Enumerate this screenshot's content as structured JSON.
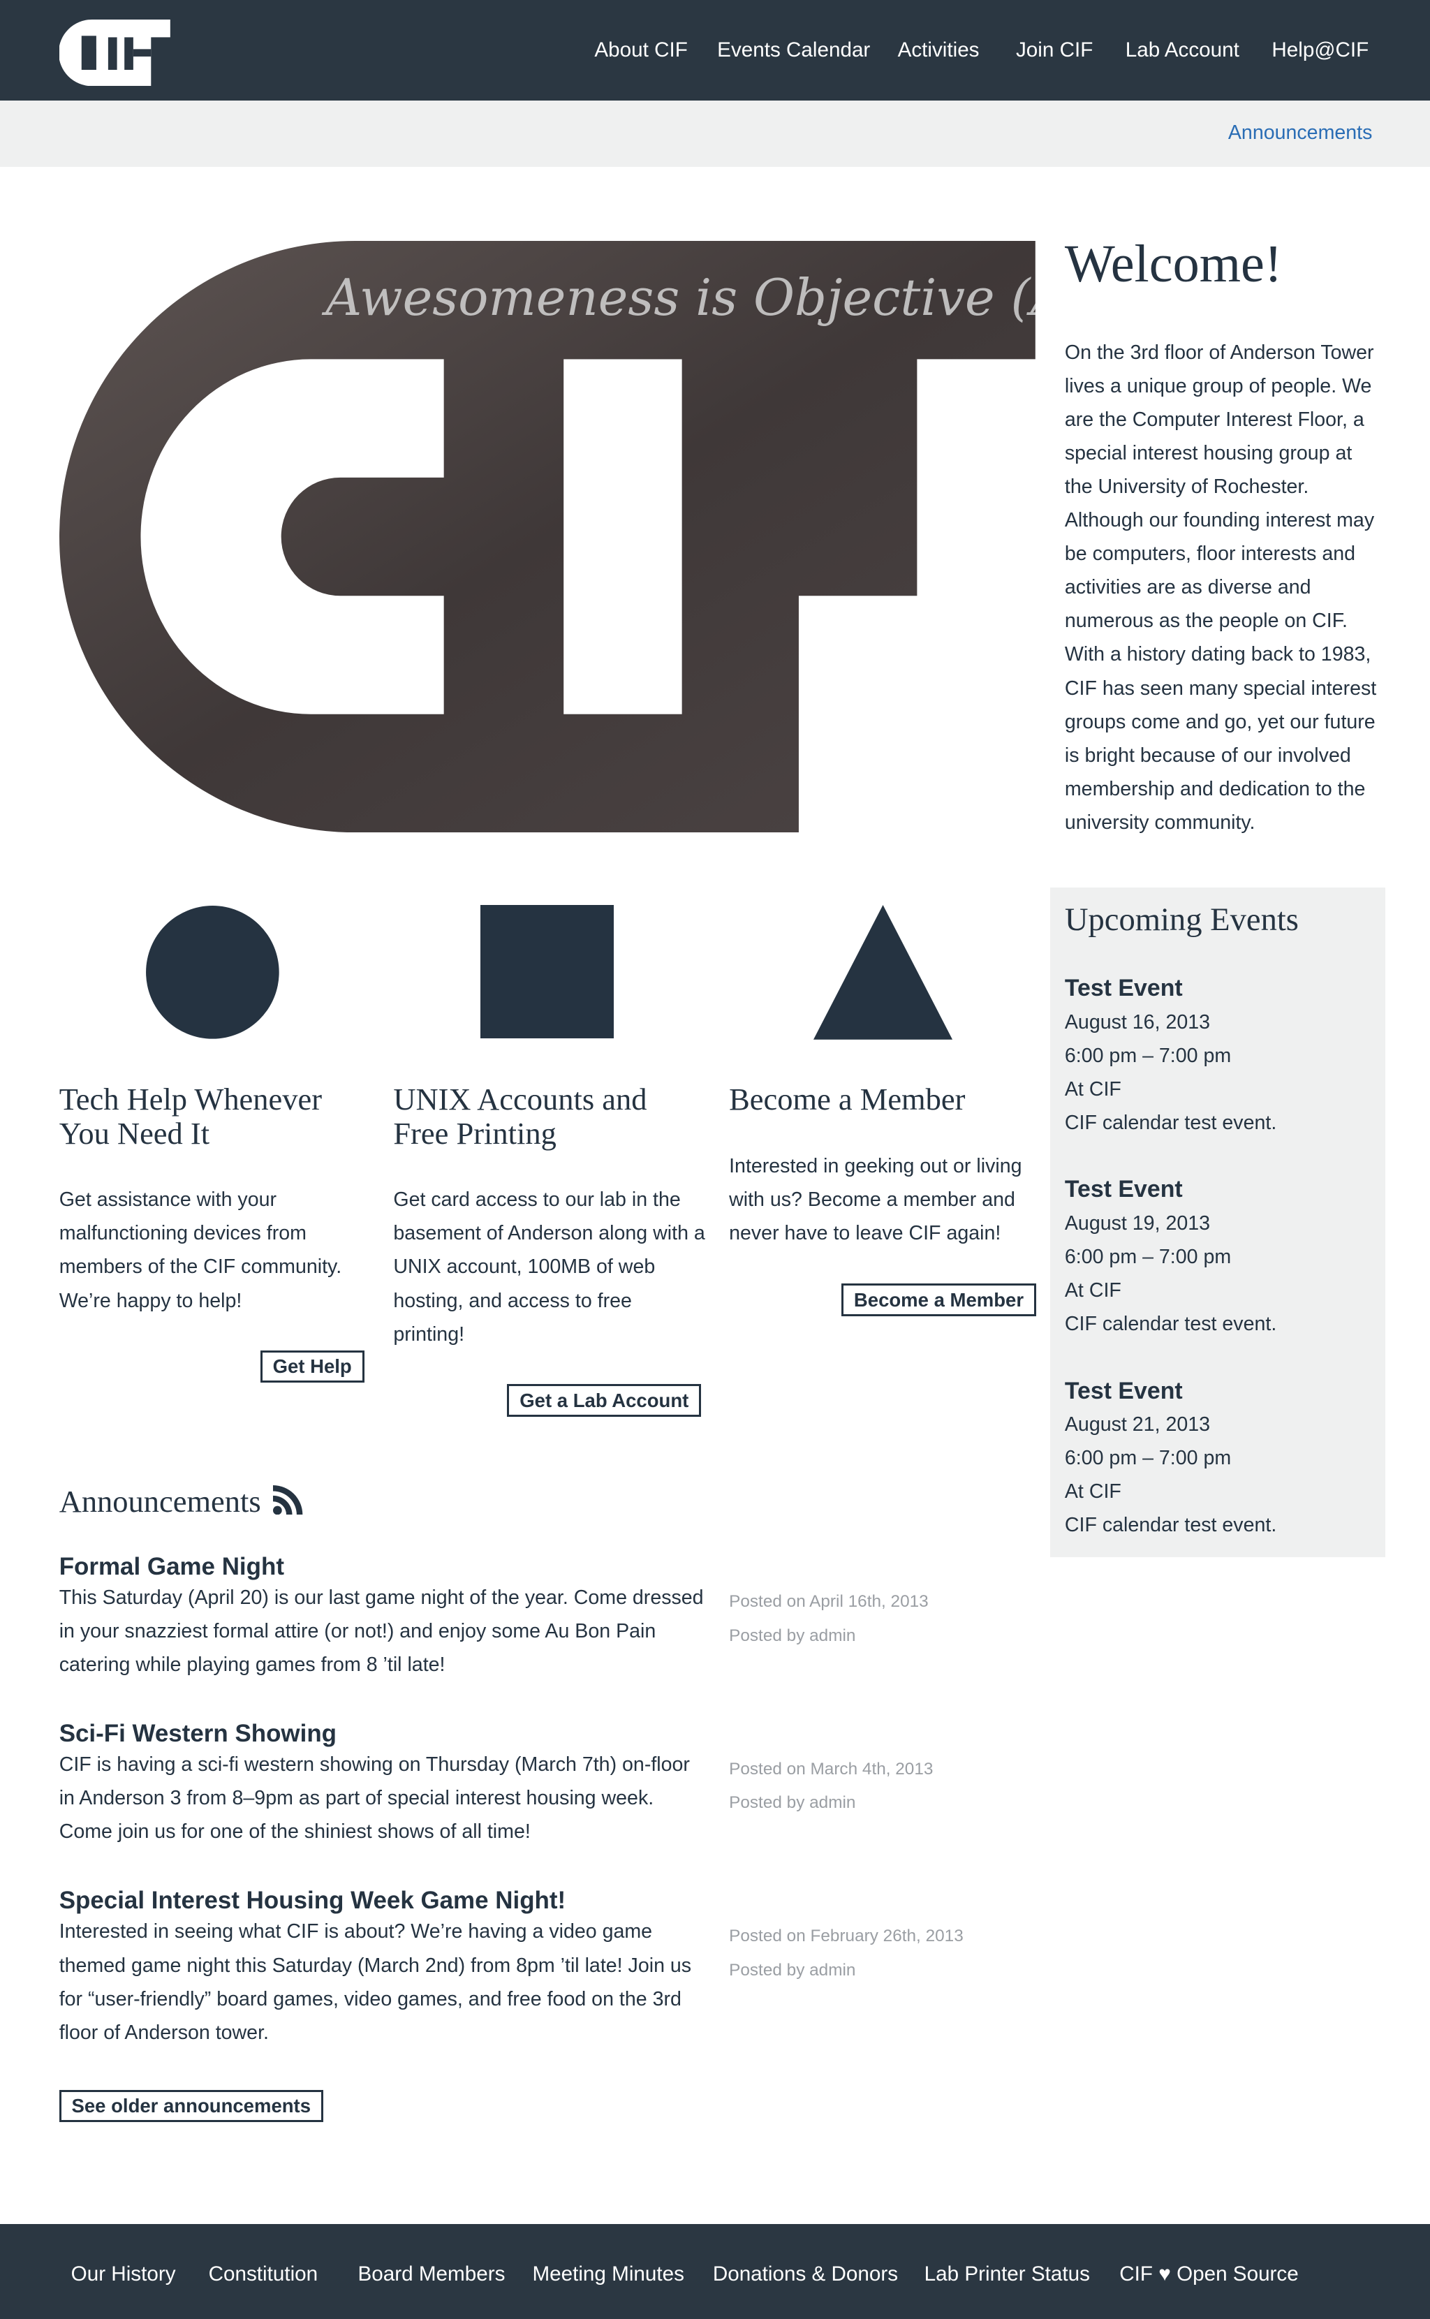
{
  "header": {
    "logo": "CIF",
    "nav": [
      "About CIF",
      "Events Calendar",
      "Activities",
      "Join CIF",
      "Lab Account",
      "Help@CIF"
    ]
  },
  "subnav": {
    "link": "Announcements",
    "link_color": "#2a6db5"
  },
  "hero": {
    "chalk_text": "Awesomeness is Objective (AT ALL times!)"
  },
  "welcome": {
    "title": "Welcome!",
    "text": "On the 3rd floor of Anderson Tower lives a unique group of people. We are the Computer Interest Floor, a special interest housing group at the University of Rochester. Although our founding interest may be computers, floor interests and activities are as diverse and numerous as the people on CIF. With a history dating back to 1983, CIF has seen many special interest groups come and go, yet our future is bright because of our involved membership and dedication to the university community."
  },
  "features": [
    {
      "icon": "circle-icon",
      "title": "Tech Help Whenever You Need It",
      "text": "Get assistance with your malfunctioning devices from members of the CIF community. We’re happy to help!",
      "button": "Get Help"
    },
    {
      "icon": "square-icon",
      "title": "UNIX Accounts and Free Printing",
      "text": "Get card access to our lab in the basement of Anderson along with a UNIX account, 100MB of web hosting, and access to free printing!",
      "button": "Get a Lab Account"
    },
    {
      "icon": "triangle-icon",
      "title": "Become a Member",
      "text": "Interested in geeking out or living with us? Become a member and never have to leave CIF again!",
      "button": "Become a Member"
    }
  ],
  "events": {
    "title": "Upcoming Events",
    "items": [
      {
        "name": "Test Event",
        "date": "August 16, 2013",
        "time": "6:00 pm – 7:00 pm",
        "location": "At CIF",
        "desc": "CIF calendar test event."
      },
      {
        "name": "Test Event",
        "date": "August 19, 2013",
        "time": "6:00 pm – 7:00 pm",
        "location": "At CIF",
        "desc": "CIF calendar test event."
      },
      {
        "name": "Test Event",
        "date": "August 21, 2013",
        "time": "6:00 pm – 7:00 pm",
        "location": "At CIF",
        "desc": "CIF calendar test event."
      }
    ]
  },
  "announcements": {
    "title": "Announcements",
    "icon": "rss-icon",
    "posts": [
      {
        "title": "Formal Game Night",
        "text": "This Saturday (April 20) is our last game night of the year. Come dressed in your snazziest formal attire (or not!) and enjoy some Au Bon Pain catering while playing games from 8 ’til late!",
        "date": "Posted on April 16th, 2013",
        "author": "Posted by admin"
      },
      {
        "title": "Sci-Fi Western Showing",
        "text": "CIF is having a sci-fi western showing on Thursday (March 7th) on-floor in Anderson 3 from 8–9pm as part of special interest housing week. Come join us for one of the shiniest shows of all time!",
        "date": "Posted on March 4th, 2013",
        "author": "Posted by admin"
      },
      {
        "title": "Special Interest Housing Week Game Night!",
        "text": "Interested in seeing what CIF is about? We’re having a video game themed game night this Saturday (March 2nd) from 8pm ’til late! Join us for “user-friendly” board games, video games, and free food on the 3rd floor of Anderson tower.",
        "date": "Posted on February 26th, 2013",
        "author": "Posted by admin"
      }
    ],
    "older": "See older announcements"
  },
  "footer": {
    "links": [
      "Our History",
      "Constitution",
      "Board Members",
      "Meeting Minutes",
      "Donations & Donors",
      "Lab Printer Status",
      "CIF ♥ Open Source"
    ]
  }
}
